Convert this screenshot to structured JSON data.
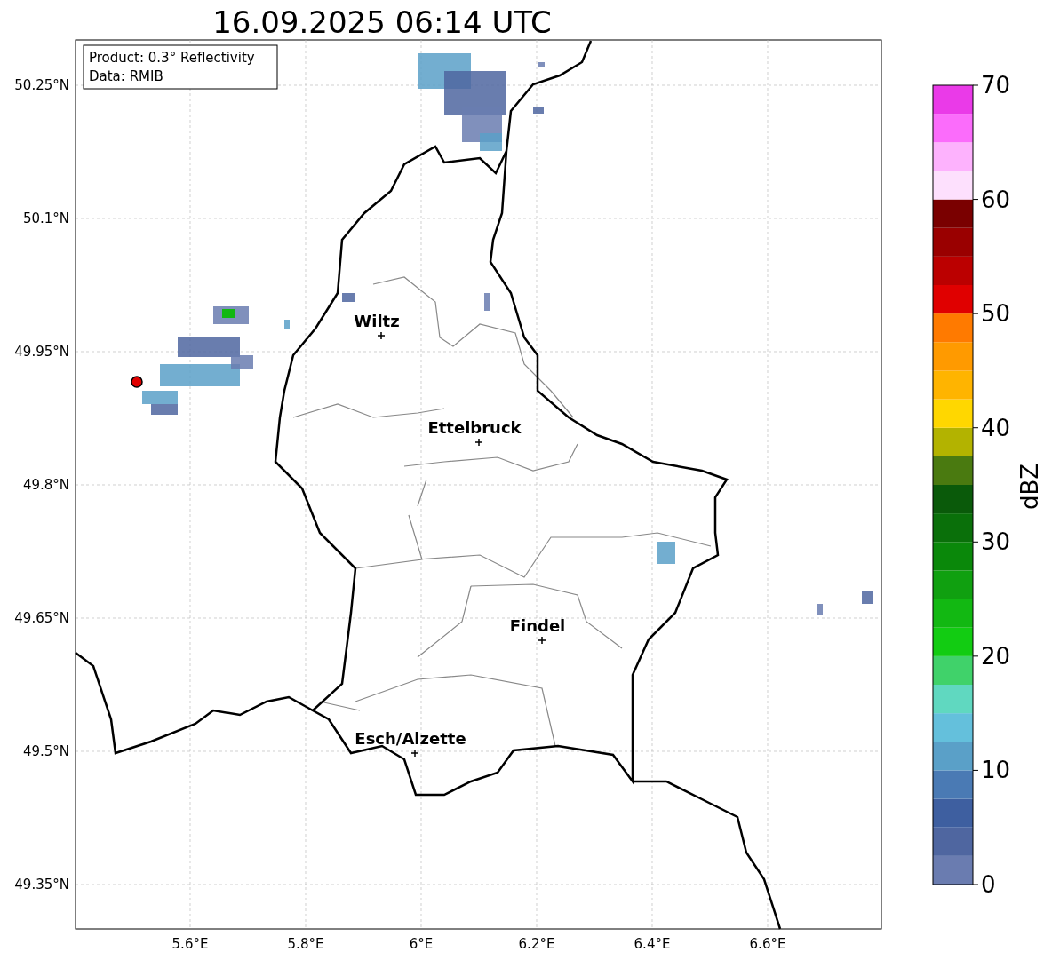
{
  "title": "16.09.2025 06:14 UTC",
  "info_box": [
    "Product: 0.3° Reflectivity",
    "Data: RMIB"
  ],
  "cities": [
    "Wiltz",
    "Ettelbruck",
    "Findel",
    "Esch/Alzette"
  ],
  "lat_ticks": [
    "50.25°N",
    "50.1°N",
    "49.95°N",
    "49.8°N",
    "49.65°N",
    "49.5°N",
    "49.35°N"
  ],
  "lon_ticks": [
    "5.6°E",
    "5.8°E",
    "6°E",
    "6.2°E",
    "6.4°E",
    "6.6°E"
  ],
  "colorbar": {
    "label": "dBZ",
    "ticks": [
      "70",
      "60",
      "50",
      "40",
      "30",
      "20",
      "10",
      "0"
    ],
    "bins": [
      {
        "color": "#6a7cb0"
      },
      {
        "color": "#4f66a0"
      },
      {
        "color": "#3e5fa0"
      },
      {
        "color": "#4a7ab4"
      },
      {
        "color": "#5aa0c8"
      },
      {
        "color": "#64c0dc"
      },
      {
        "color": "#60d8c0"
      },
      {
        "color": "#40d26a"
      },
      {
        "color": "#12cc12"
      },
      {
        "color": "#12b812"
      },
      {
        "color": "#10a010"
      },
      {
        "color": "#0a880a"
      },
      {
        "color": "#0a700a"
      },
      {
        "color": "#0a5a0a"
      },
      {
        "color": "#4a7a10"
      },
      {
        "color": "#b3b300"
      },
      {
        "color": "#ffd700"
      },
      {
        "color": "#ffb400"
      },
      {
        "color": "#ff9a00"
      },
      {
        "color": "#ff7a00"
      },
      {
        "color": "#e00000"
      },
      {
        "color": "#bb0000"
      },
      {
        "color": "#9a0000"
      },
      {
        "color": "#7a0000"
      },
      {
        "color": "#fde0fd"
      },
      {
        "color": "#fdb2fd"
      },
      {
        "color": "#fb6cfb"
      },
      {
        "color": "#ea3ae8"
      }
    ]
  }
}
